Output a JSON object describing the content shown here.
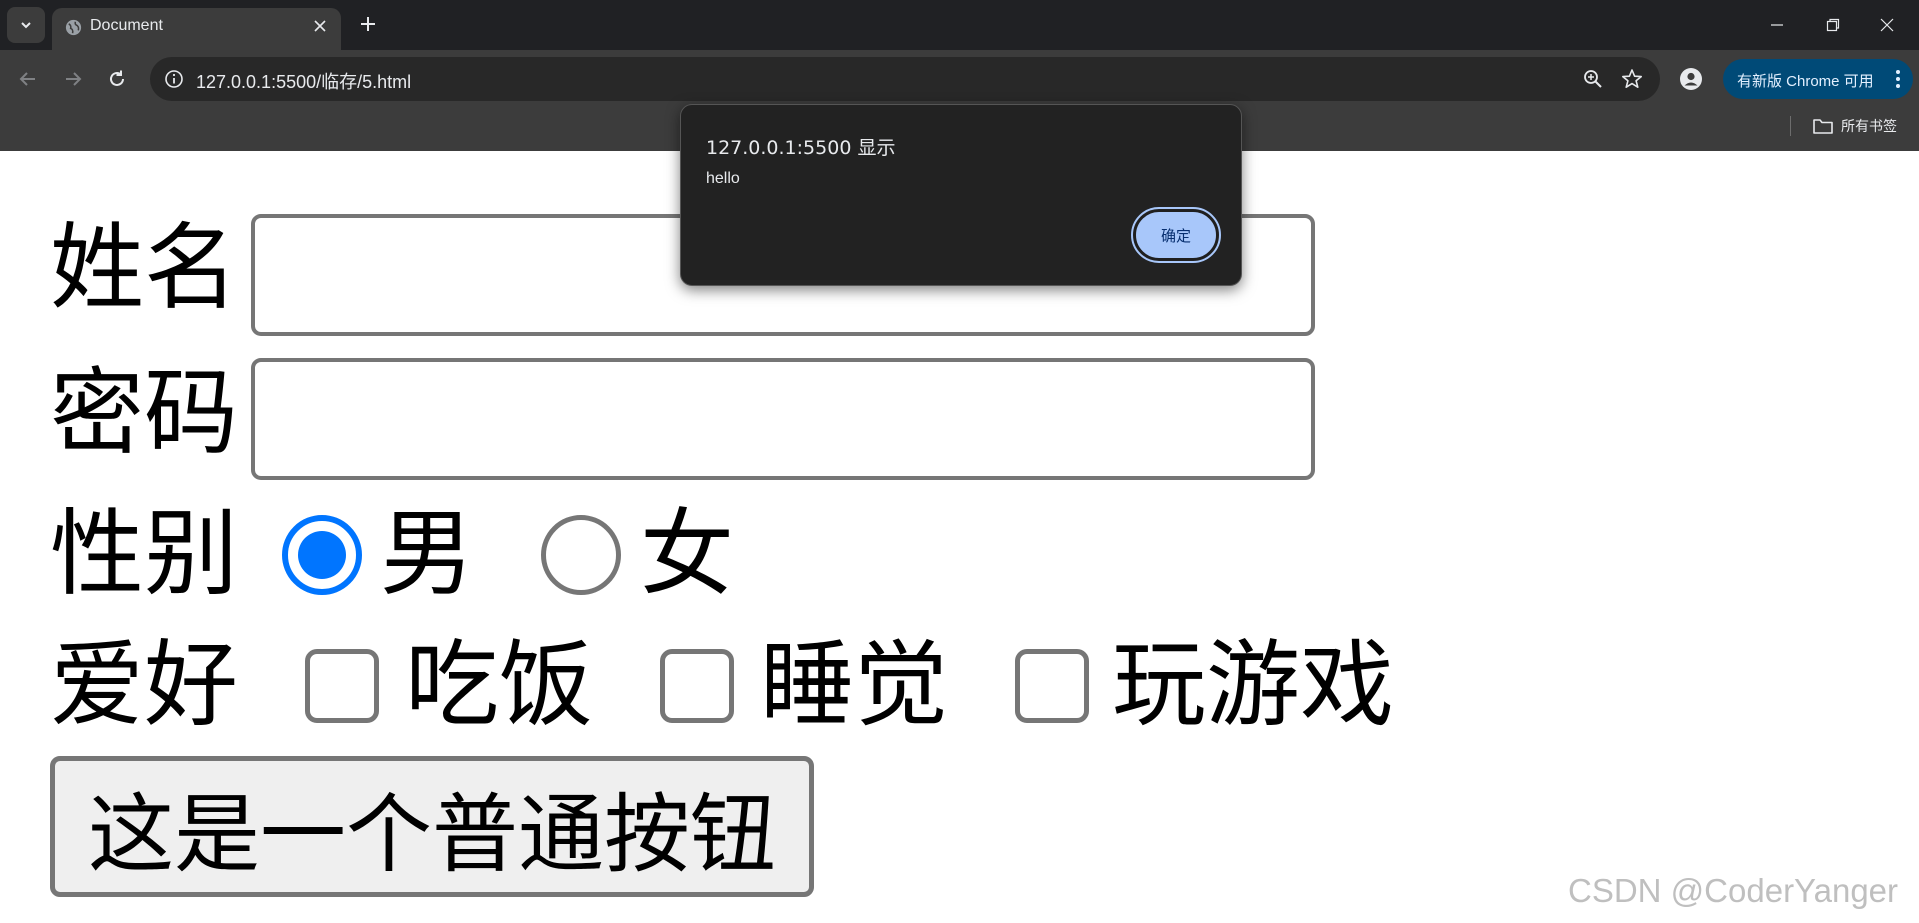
{
  "browser": {
    "tab_title": "Document",
    "address": "127.0.0.1:5500/临存/5.html",
    "update_chip_label": "有新版 Chrome 可用",
    "bookmarks_folder_label": "所有书签"
  },
  "dialog": {
    "title": "127.0.0.1:5500 显示",
    "message": "hello",
    "ok_label": "确定"
  },
  "form": {
    "name_label": "姓名",
    "name_value": "",
    "password_label": "密码",
    "password_value": "",
    "gender_label": "性别",
    "gender_options": [
      {
        "label": "男",
        "checked": true
      },
      {
        "label": "女",
        "checked": false
      }
    ],
    "hobby_label": "爱好",
    "hobby_options": [
      {
        "label": "吃饭",
        "checked": false
      },
      {
        "label": "睡觉",
        "checked": false
      },
      {
        "label": "玩游戏",
        "checked": false
      }
    ],
    "button_label": "这是一个普通按钮"
  },
  "watermark": "CSDN @CoderYanger",
  "colors": {
    "accent": "#0075ff",
    "dialog_button": "#a8c7fa",
    "chrome_dark": "#202124",
    "toolbar": "#3c3c3c",
    "update_chip": "#004a77"
  },
  "icons": {
    "tab_search": "chevron-down-icon",
    "favicon": "globe-icon",
    "tab_close": "close-icon",
    "new_tab": "plus-icon",
    "back": "arrow-left-icon",
    "forward": "arrow-right-icon",
    "reload": "reload-icon",
    "site_info": "info-icon",
    "zoom": "zoom-icon",
    "bookmark": "star-icon",
    "profile": "profile-icon",
    "menu": "kebab-menu-icon",
    "bookmarks_folder": "folder-icon"
  }
}
